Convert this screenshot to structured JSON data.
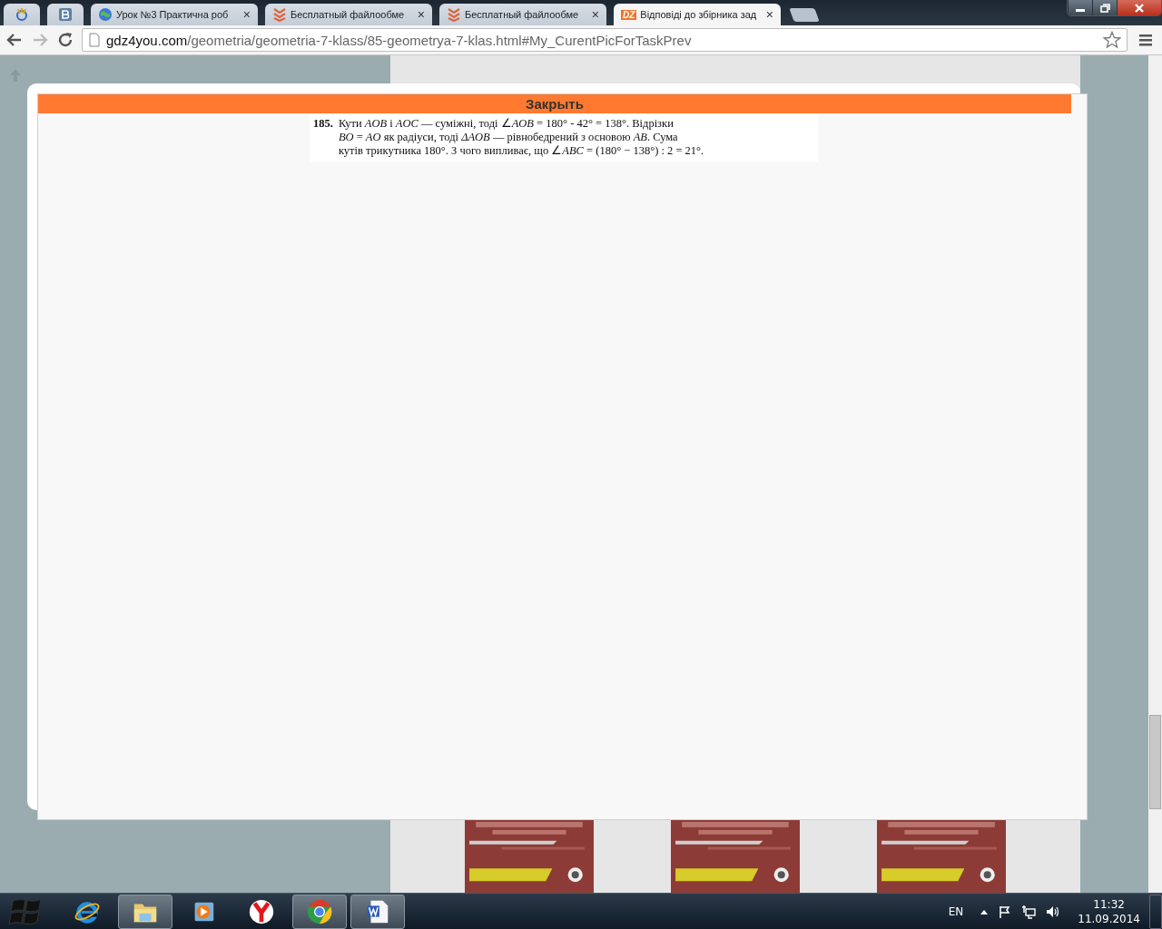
{
  "tabs": [
    {
      "kind": "pinned",
      "selected": false
    },
    {
      "kind": "pinned",
      "selected": false
    },
    {
      "kind": "page",
      "label": "Урок №3 Практична роб",
      "close": "×",
      "selected": false
    },
    {
      "kind": "page",
      "label": "Бесплатный файлообме",
      "close": "×",
      "selected": false
    },
    {
      "kind": "page",
      "label": "Бесплатный файлообме",
      "close": "×",
      "selected": false
    },
    {
      "kind": "page",
      "label": "Відповіді до збірника зад",
      "badge": "DZ",
      "close": "×",
      "selected": true
    }
  ],
  "address": {
    "host": "gdz4you.com",
    "path": "/geometria/geometria-7-klass/85-geometrya-7-klas.html#My_CurentPicForTaskPrev"
  },
  "modal": {
    "close_label": "Закрыть",
    "number": "185.",
    "lines": [
      "Кути *AOB* і *AOC* — суміжні, тоді ∠*AOB* = 180° - 42° = 138°. Відрізки",
      "*BO* = *AO* як радіуси, тоді *ΔAOB* — рівнобедрений з основою *AB*. Сума",
      "кутів трикутника 180°. З чого випливає, що ∠*ABC* = (180° − 138°) : 2 = 21°."
    ]
  },
  "taskbar": {
    "apps": [
      {
        "kind": "ie",
        "running": false
      },
      {
        "kind": "folder",
        "running": true
      },
      {
        "kind": "media",
        "running": false
      },
      {
        "kind": "yandex",
        "running": false
      },
      {
        "kind": "chrome",
        "running": true
      },
      {
        "kind": "word",
        "running": true
      }
    ],
    "language": "EN",
    "time": "11:32",
    "date": "11.09.2014"
  }
}
